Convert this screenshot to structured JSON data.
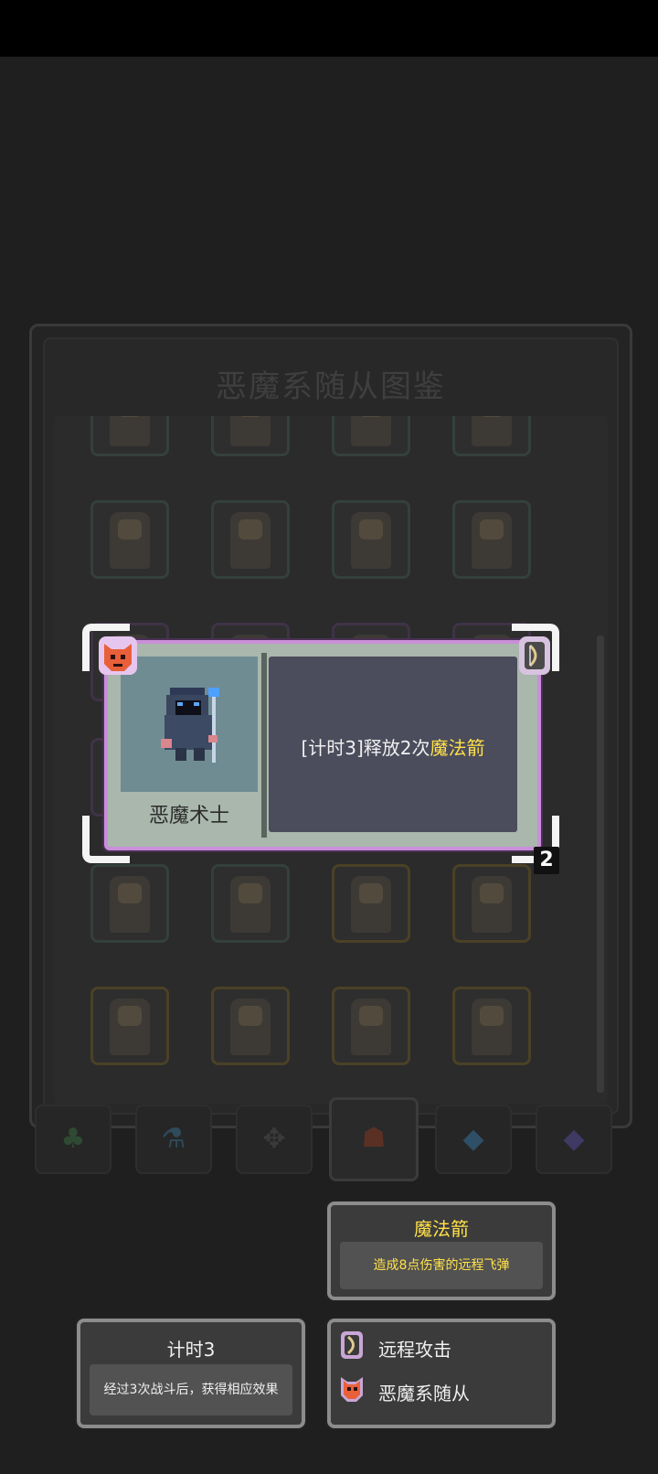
{
  "collection": {
    "title": "恶魔系随从图鉴"
  },
  "tabs": [
    {
      "icon": "clover-icon",
      "glyph": "♣",
      "color": "#2f4a32"
    },
    {
      "icon": "potion-icon",
      "glyph": "⚗",
      "color": "#2f4a5a"
    },
    {
      "icon": "cross-rune-icon",
      "glyph": "✥",
      "color": "#3a3a3a"
    },
    {
      "icon": "demon-mask-icon",
      "glyph": "☗",
      "color": "#5a3025"
    },
    {
      "icon": "blue-gem-icon",
      "glyph": "◆",
      "color": "#2e4f66"
    },
    {
      "icon": "purple-gem-icon",
      "glyph": "◆",
      "color": "#3e3a63"
    }
  ],
  "card": {
    "unit_name": "恶魔术士",
    "desc_prefix": "[计时3]释放2次",
    "desc_highlight": "魔法箭",
    "level": "2",
    "faction_icon": "demon-mask-icon",
    "type_icon": "bow-icon",
    "border_color": "#c98fd8"
  },
  "tooltips": {
    "magic_arrow": {
      "title": "魔法箭",
      "body": "造成8点伤害的远程飞弹"
    },
    "timer": {
      "title": "计时3",
      "body": "经过3次战斗后，获得相应效果"
    },
    "keywords": [
      {
        "icon": "bow-icon",
        "label": "远程攻击"
      },
      {
        "icon": "demon-mask-icon",
        "label": "恶魔系随从"
      }
    ]
  }
}
